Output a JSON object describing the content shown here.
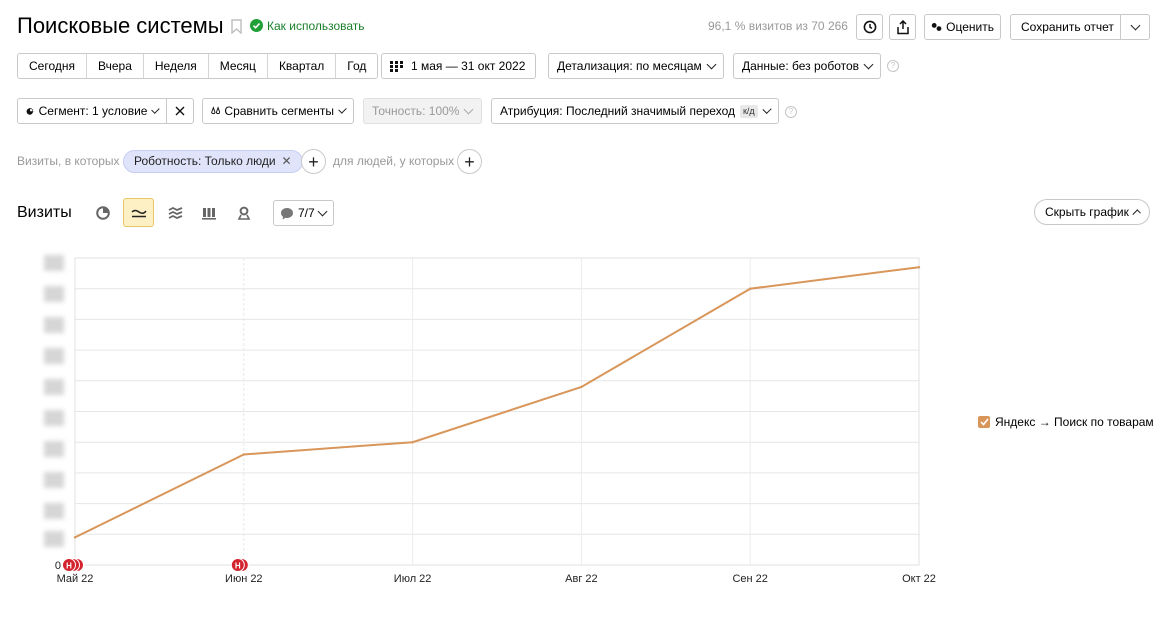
{
  "header": {
    "title": "Поисковые системы",
    "howto": "Как использовать",
    "visits_share": "96,1 % визитов из 70 266",
    "rate_label": "Оценить",
    "save_report_label": "Сохранить отчет"
  },
  "periods": [
    "Сегодня",
    "Вчера",
    "Неделя",
    "Месяц",
    "Квартал",
    "Год"
  ],
  "date_range": "1 мая — 31 окт 2022",
  "detail": "Детализация: по месяцам",
  "data_filter": "Данные: без роботов",
  "segment": "Сегмент: 1 условие",
  "compare": "Сравнить сегменты",
  "accuracy": "Точность: 100%",
  "attribution": "Атрибуция: Последний значимый переход",
  "attribution_badge": "к/д",
  "filter_row": {
    "prefix": "Визиты, в которых",
    "pill": "Роботность: Только люди",
    "people": "для людей, у которых"
  },
  "chart_toolbar": {
    "title": "Визиты",
    "notes": "7/7",
    "hide_chart": "Скрыть график"
  },
  "accent_color": "#d8965a",
  "chart_data": {
    "type": "line",
    "categories": [
      "Май 22",
      "Июн 22",
      "Июл 22",
      "Авг 22",
      "Сен 22",
      "Окт 22"
    ],
    "series": [
      {
        "name": "Яндекс → Поиск по товарам",
        "values": [
          0.9,
          3.6,
          4.0,
          5.8,
          9.0,
          9.7
        ]
      }
    ],
    "ylim": [
      0,
      10
    ],
    "ytick_labels": [
      "0"
    ],
    "legend": "right",
    "grid": true,
    "markers": [
      {
        "category": "Май 22",
        "label": "Н"
      },
      {
        "category": "Июн 22",
        "label": "Н"
      }
    ]
  }
}
